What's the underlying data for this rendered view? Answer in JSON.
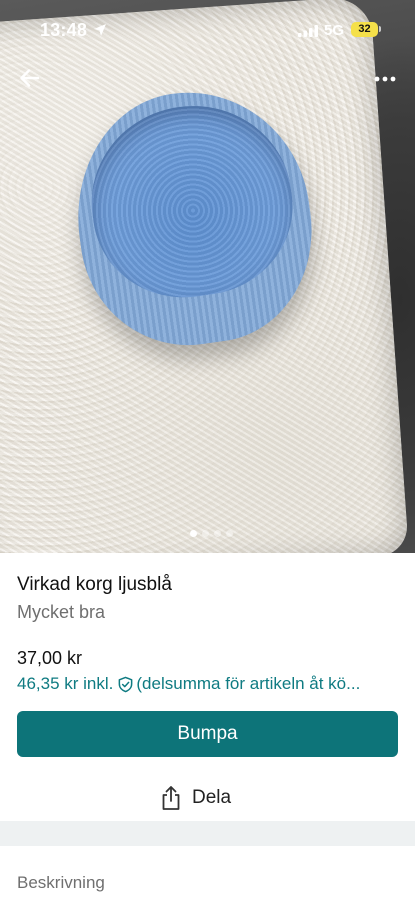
{
  "status_bar": {
    "time": "13:48",
    "network": "5G",
    "battery": "32"
  },
  "icons": {
    "back": "arrow-left-icon",
    "more": "more-horizontal-icon",
    "share": "share-icon",
    "shield": "shield-check-icon"
  },
  "gallery": {
    "image_count": 4,
    "active_index": 0
  },
  "item": {
    "title": "Virkad korg ljusblå",
    "condition": "Mycket bra",
    "price": "37,00 kr",
    "price_incl": "46,35 kr inkl.",
    "price_incl_note": "(delsumma för artikeln åt kö..."
  },
  "actions": {
    "bump_label": "Bumpa",
    "share_label": "Dela"
  },
  "description": {
    "heading": "Beskrivning"
  },
  "colors": {
    "accent": "#0d7479",
    "link": "#0f7b82",
    "battery": "#f5e04a"
  }
}
